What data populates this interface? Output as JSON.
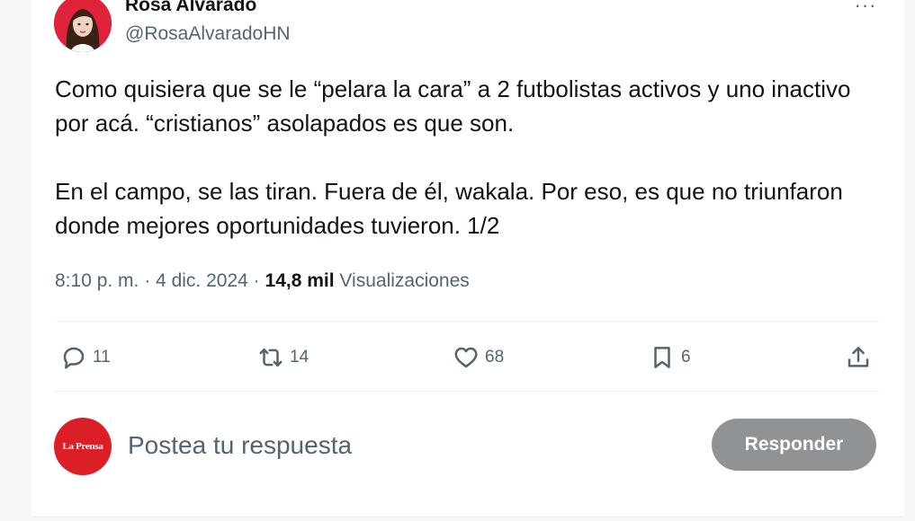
{
  "tweet": {
    "author_name": "Rosa Alvarado",
    "author_handle": "@RosaAlvaradoHN",
    "more_label": "···",
    "paragraphs": [
      "Como quisiera que se le “pelara la cara” a 2 futbolistas activos y uno inactivo por acá. “cristianos” asolapados es que son.",
      "En el campo, se las tiran. Fuera de él, wakala. Por eso, es que no triunfaron donde mejores oportunidades tuvieron. 1/2"
    ],
    "time": "8:10 p. m.",
    "separator": "·",
    "date": "4 dic. 2024",
    "views_count": "14,8 mil",
    "views_label": "Visualizaciones"
  },
  "actions": {
    "replies": "11",
    "retweets": "14",
    "likes": "68",
    "bookmarks": "6"
  },
  "reply_box": {
    "avatar_text": "La Prensa",
    "placeholder": "Postea tu respuesta",
    "button_label": "Responder"
  },
  "icons": [
    "more-icon",
    "reply-icon",
    "retweet-icon",
    "like-icon",
    "bookmark-icon",
    "share-icon"
  ],
  "colors": {
    "text": "#0f1419",
    "secondary": "#536471",
    "button_disabled": "#8f9396",
    "brand_red": "#dc1f26"
  }
}
